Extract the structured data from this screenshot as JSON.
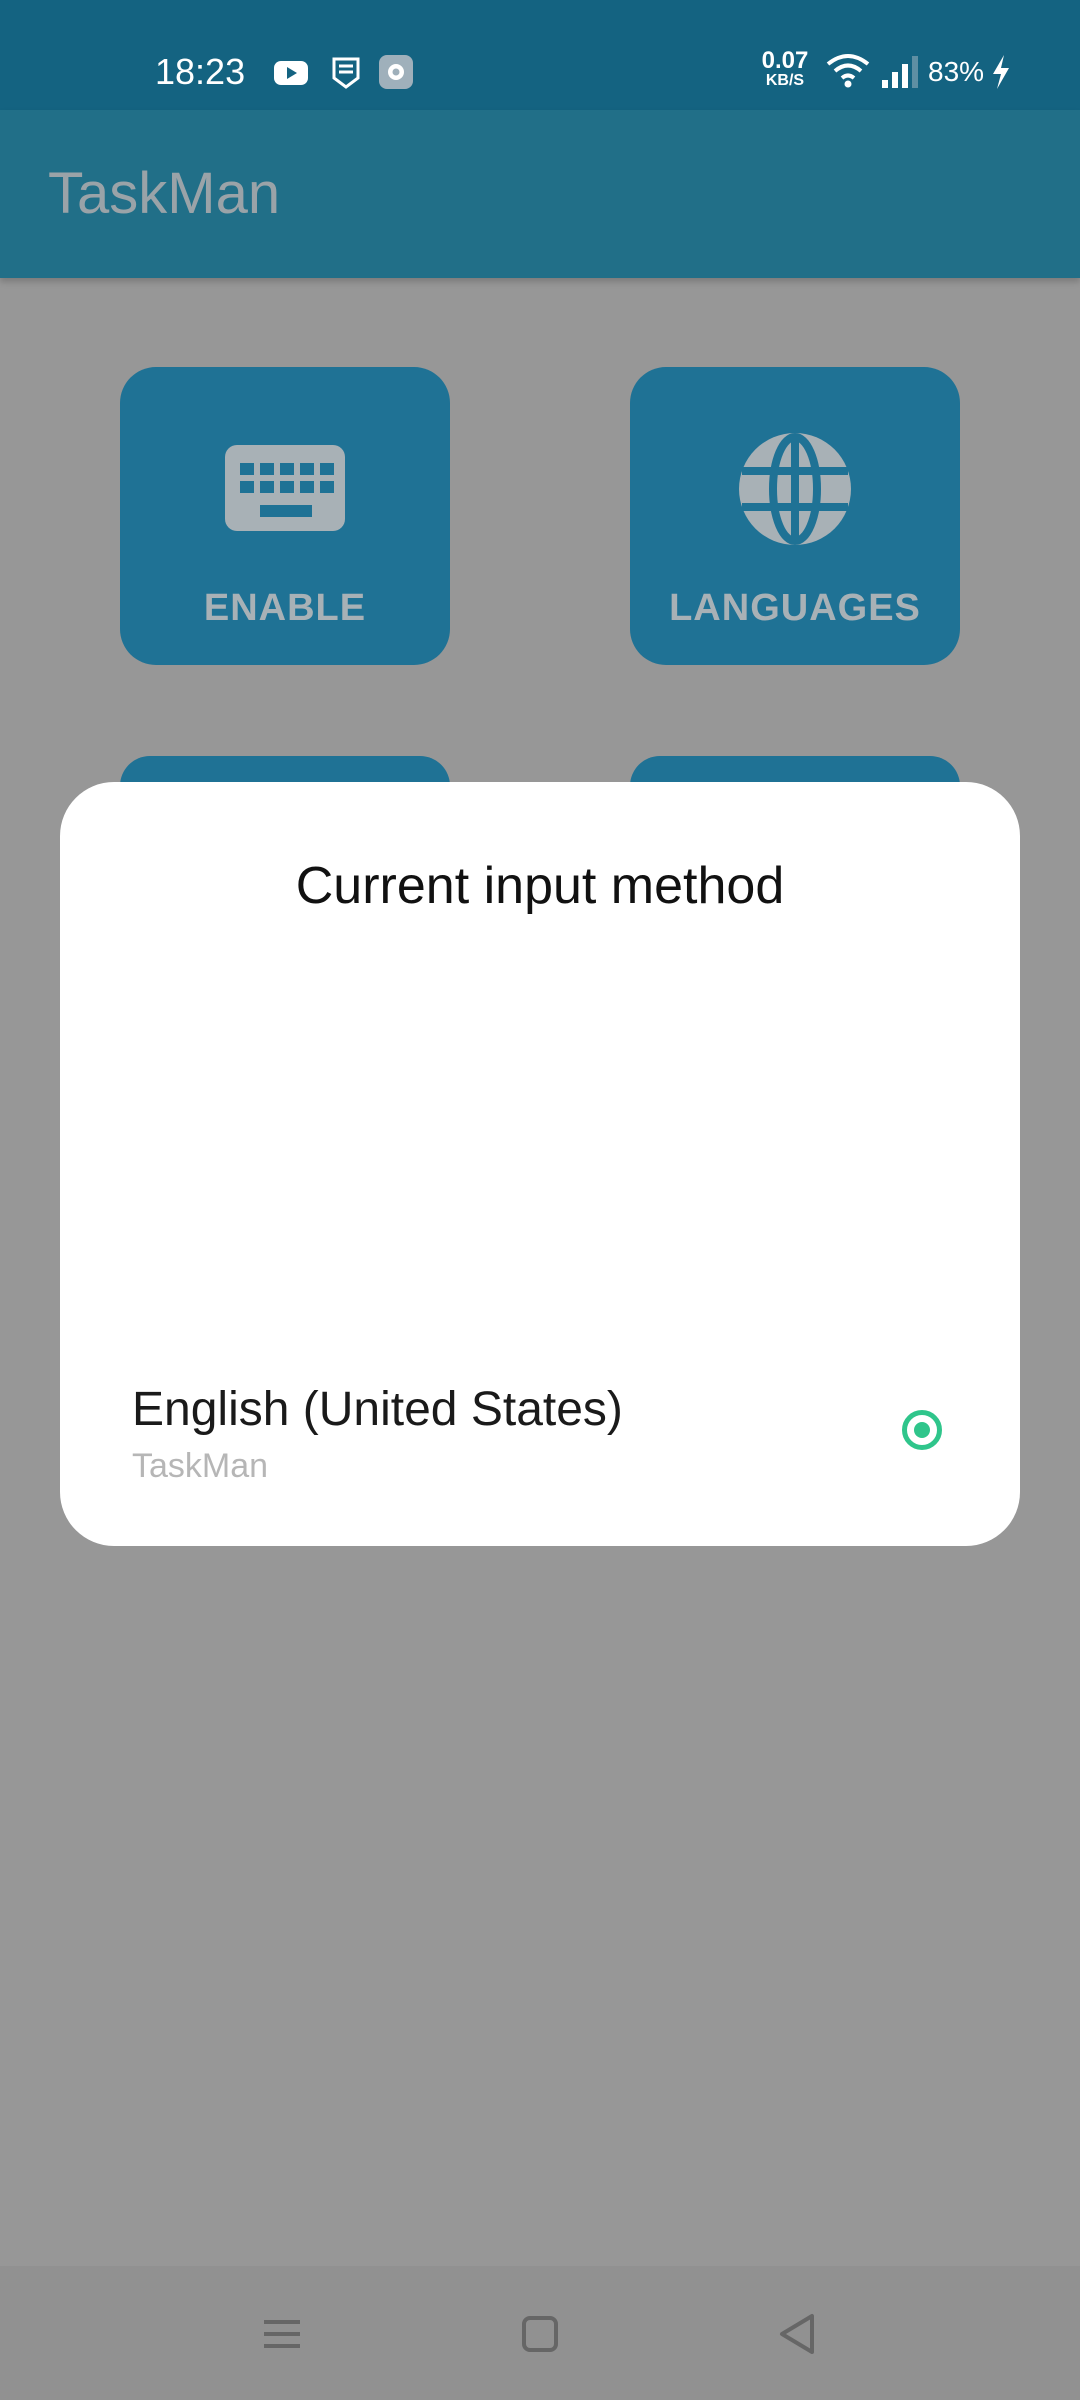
{
  "status_bar": {
    "time": "18:23",
    "net_speed_value": "0.07",
    "net_speed_unit": "KB/S",
    "battery": "83%",
    "icons": [
      "youtube-icon",
      "shield-badge-icon",
      "settings-gear-icon",
      "wifi-icon",
      "cell-signal-icon",
      "charging-bolt-icon"
    ]
  },
  "app_bar": {
    "title": "TaskMan"
  },
  "tiles": [
    {
      "label": "ENABLE",
      "icon": "keyboard-icon"
    },
    {
      "label": "LANGUAGES",
      "icon": "globe-icon"
    }
  ],
  "dialog": {
    "title": "Current input method",
    "option": {
      "label": "English (United States)",
      "sublabel": "TaskMan",
      "selected": true
    }
  },
  "nav_bar": {
    "buttons": [
      "menu-icon",
      "home-icon",
      "back-icon"
    ]
  },
  "colors": {
    "status_bar": "#146381",
    "app_bar": "#216f88",
    "tile": "#1f7295",
    "scrim_bg": "#979797",
    "radio_accent": "#2fc58b"
  }
}
